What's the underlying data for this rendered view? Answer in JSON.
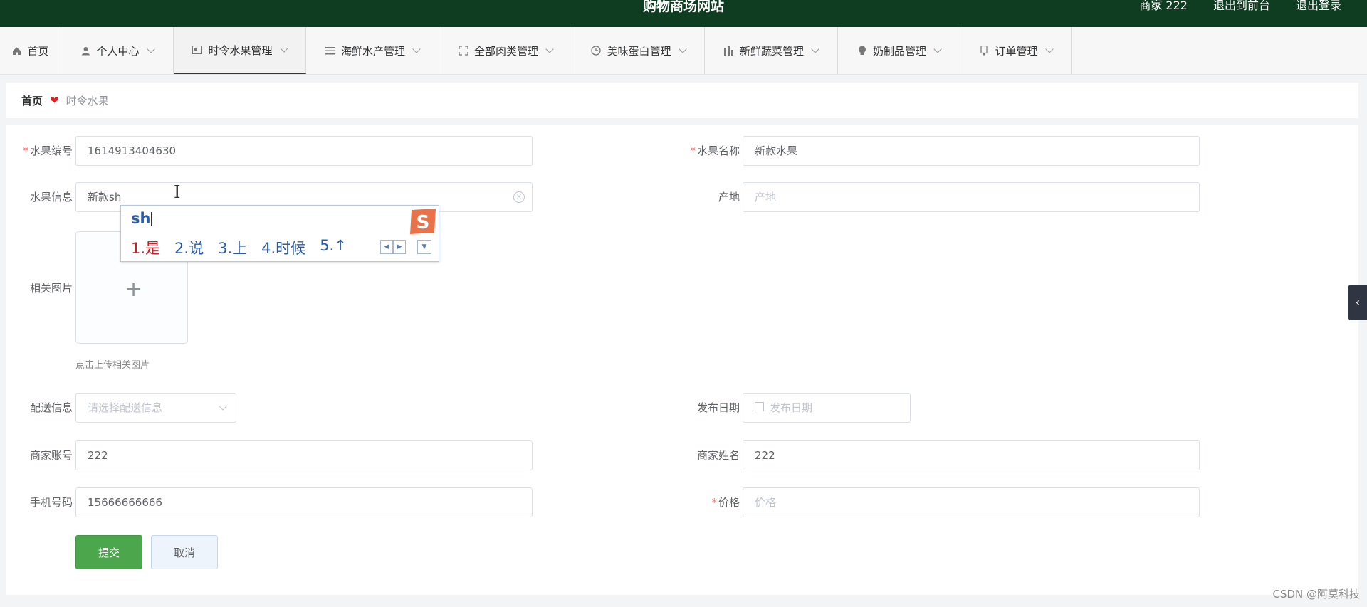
{
  "header": {
    "title": "购物商场网站",
    "user": "商家 222",
    "to_front": "退出到前台",
    "logout": "退出登录"
  },
  "nav": {
    "items": [
      {
        "label": "首页",
        "icon": "home-icon"
      },
      {
        "label": "个人中心",
        "icon": "user-icon"
      },
      {
        "label": "时令水果管理",
        "icon": "card-icon"
      },
      {
        "label": "海鲜水产管理",
        "icon": "list-icon"
      },
      {
        "label": "全部肉类管理",
        "icon": "fullscreen-icon"
      },
      {
        "label": "美味蛋白管理",
        "icon": "clock-icon"
      },
      {
        "label": "新鲜蔬菜管理",
        "icon": "bar-icon"
      },
      {
        "label": "奶制品管理",
        "icon": "bulb-icon"
      },
      {
        "label": "订单管理",
        "icon": "order-icon"
      }
    ],
    "active_index": 2
  },
  "breadcrumb": {
    "home": "首页",
    "separator": "❤",
    "current": "时令水果"
  },
  "form": {
    "fruit_id": {
      "label": "水果编号",
      "required": "*",
      "value": "1614913404630"
    },
    "fruit_name": {
      "label": "水果名称",
      "required": "*",
      "value": "新款水果"
    },
    "fruit_info": {
      "label": "水果信息",
      "value": "新款sh"
    },
    "origin": {
      "label": "产地",
      "placeholder": "产地"
    },
    "image": {
      "label": "相关图片",
      "plus": "+",
      "hint": "点击上传相关图片"
    },
    "delivery": {
      "label": "配送信息",
      "placeholder": "请选择配送信息"
    },
    "publish_date": {
      "label": "发布日期",
      "placeholder": "发布日期"
    },
    "merchant_account": {
      "label": "商家账号",
      "value": "222"
    },
    "merchant_name": {
      "label": "商家姓名",
      "value": "222"
    },
    "phone": {
      "label": "手机号码",
      "value": "15666666666"
    },
    "price": {
      "label": "价格",
      "required": "*",
      "placeholder": "价格"
    },
    "submit": "提交",
    "cancel": "取消"
  },
  "ime": {
    "composition": "sh",
    "candidates": [
      "1.是",
      "2.说",
      "3.上",
      "4.时候",
      "5.↑"
    ],
    "logo_letter": "S"
  },
  "side_tab": "‹",
  "watermark": "CSDN @阿莫科技",
  "colors": {
    "header_bg": "#0f3d22",
    "primary": "#4ca64c",
    "required": "#f56c6c",
    "ime_text": "#2c5ca8",
    "ime_first": "#c8202a"
  }
}
